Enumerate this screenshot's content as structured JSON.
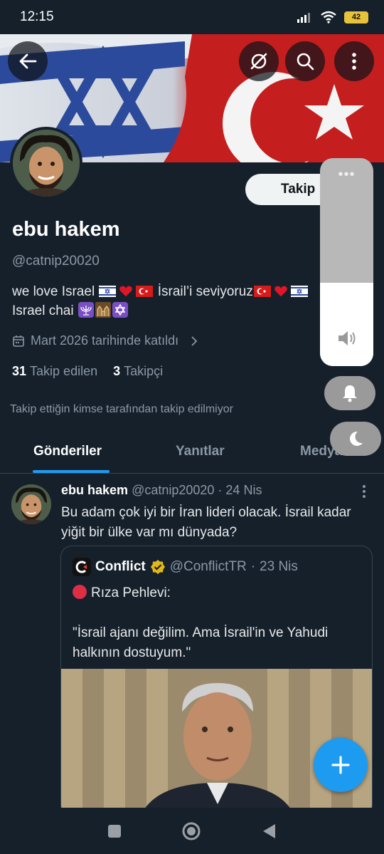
{
  "status_bar": {
    "time": "12:15",
    "battery": "42"
  },
  "profile": {
    "follow_label": "Takip",
    "name": "ebu hakem",
    "handle": "@catnip20020",
    "bio_line1_a": "we love Israel ",
    "bio_line1_b": " İsrail’i seviyoruz",
    "bio_line2": "Israel chai ",
    "joined": "Mart 2026 tarihinde katıldı",
    "following_count": "31",
    "following_label": "Takip edilen",
    "followers_count": "3",
    "followers_label": "Takipçi",
    "not_followed": "Takip ettiğin kimse tarafından takip edilmiyor"
  },
  "tabs": [
    {
      "label": "Gönderiler",
      "active": true
    },
    {
      "label": "Yanıtlar",
      "active": false
    },
    {
      "label": "Medya",
      "active": false
    }
  ],
  "tweet": {
    "name": "ebu hakem",
    "handle": "@catnip20020",
    "sep": " · ",
    "date": "24 Nis",
    "text": "Bu adam çok iyi bir İran lideri olacak. İsrail kadar yiğit bir ülke var mı dünyada?",
    "quote": {
      "name": "Conflict",
      "handle": "@ConflictTR",
      "date": "23 Nis",
      "line1": "Rıza Pehlevi:",
      "line2": "\"İsrail ajanı değilim. Ama İsrail'in ve Yahudi halkının dostuyum.\""
    }
  },
  "volume": {
    "dots": "•••",
    "level": 0.4
  },
  "colors": {
    "background": "#15202b",
    "accent": "#1d9bf0",
    "muted": "#8b98a5",
    "border": "#38444d"
  },
  "icons": [
    "back-arrow-icon",
    "no-sync-icon",
    "search-icon",
    "more-vert-icon",
    "calendar-icon",
    "chevron-right-icon",
    "verified-badge-icon",
    "plus-icon",
    "speaker-icon",
    "bell-icon",
    "moon-icon",
    "recents-square-icon",
    "home-circle-icon",
    "back-triangle-icon"
  ]
}
